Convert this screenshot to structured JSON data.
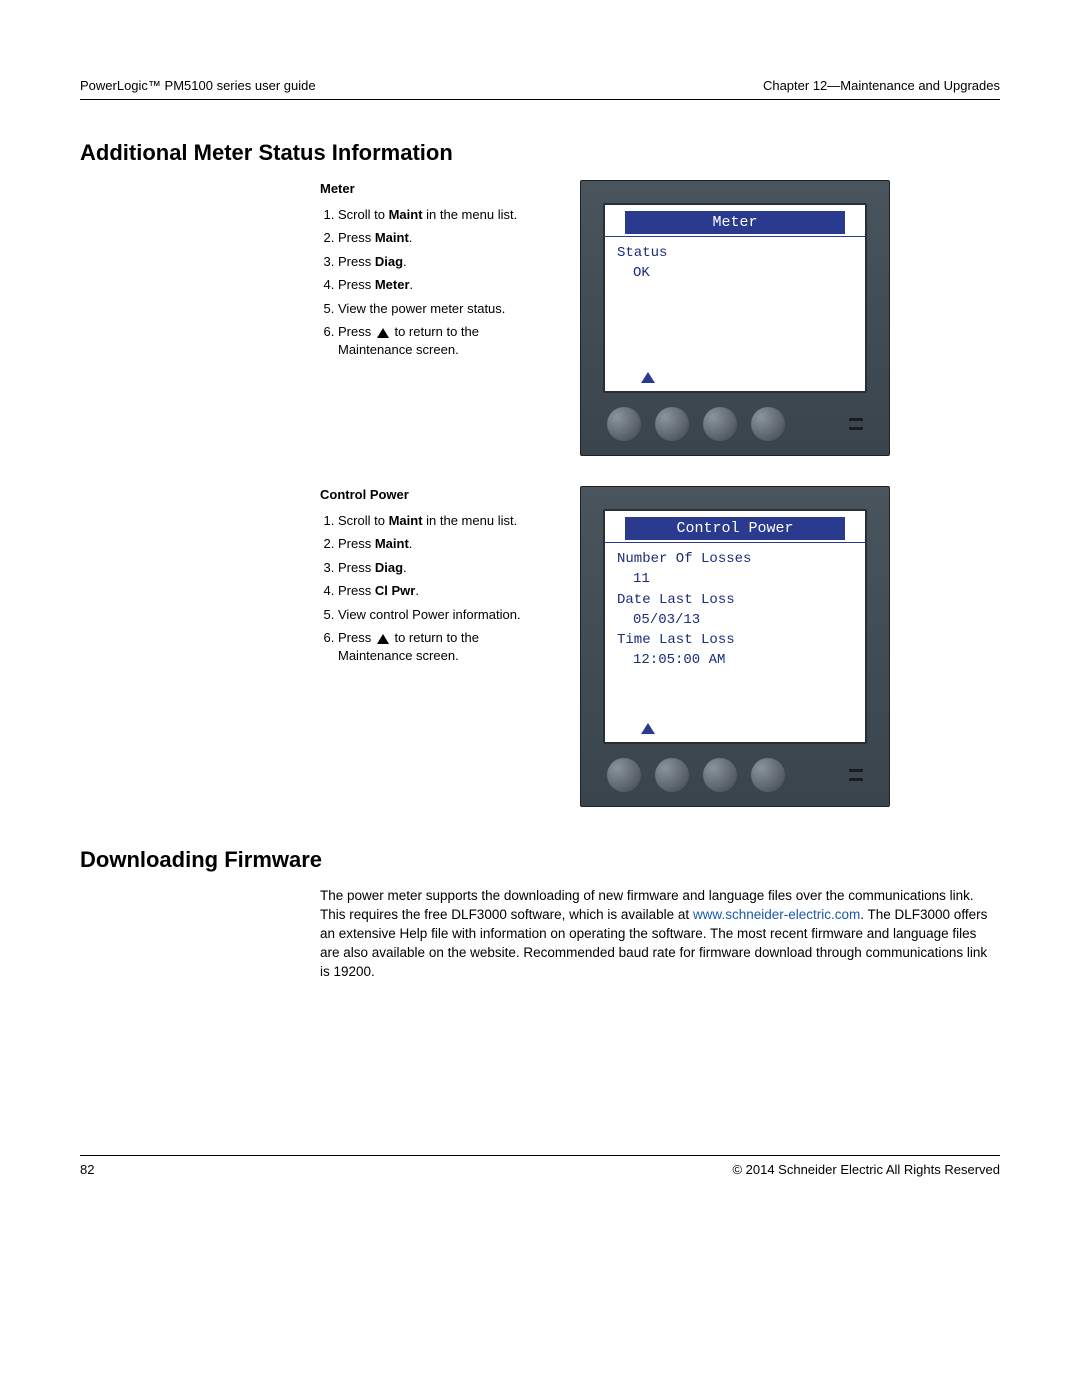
{
  "header": {
    "left": "PowerLogic™ PM5100 series user guide",
    "right": "Chapter 12—Maintenance and Upgrades"
  },
  "section1": {
    "title": "Additional Meter Status Information",
    "meter": {
      "heading": "Meter",
      "s1a": "Scroll to ",
      "s1b": "Maint",
      "s1c": " in the menu list.",
      "s2a": "Press ",
      "s2b": "Maint",
      "s2c": ".",
      "s3a": "Press ",
      "s3b": "Diag",
      "s3c": ".",
      "s4a": "Press ",
      "s4b": "Meter",
      "s4c": ".",
      "s5": "View the power meter status.",
      "s6a": "Press ",
      "s6b": " to return to the Maintenance screen."
    },
    "meterScreen": {
      "title": "Meter",
      "line1": "Status",
      "line2": "OK"
    },
    "control": {
      "heading": "Control Power",
      "s1a": "Scroll to ",
      "s1b": "Maint",
      "s1c": " in the menu list.",
      "s2a": "Press ",
      "s2b": "Maint",
      "s2c": ".",
      "s3a": "Press ",
      "s3b": "Diag",
      "s3c": ".",
      "s4a": "Press ",
      "s4b": "Cl Pwr",
      "s4c": ".",
      "s5": "View control Power information.",
      "s6a": "Press ",
      "s6b": " to return to the Maintenance screen."
    },
    "controlScreen": {
      "title": "Control Power",
      "l1": "Number Of Losses",
      "v1": "11",
      "l2": "Date Last Loss",
      "v2": "05/03/13",
      "l3": "Time Last Loss",
      "v3": "12:05:00 AM"
    }
  },
  "section2": {
    "title": "Downloading Firmware",
    "p1": "The power meter supports the downloading of new firmware and language files over the communications link. This requires the free DLF3000 software, which is available at ",
    "link": "www.schneider-electric.com",
    "p2": ". The DLF3000 offers an extensive Help file with information on operating the software. The most recent firmware and language files are also available on the website. Recommended baud rate for firmware download through communications link is 19200."
  },
  "footer": {
    "page": "82",
    "copyright": "© 2014 Schneider Electric All Rights Reserved"
  }
}
